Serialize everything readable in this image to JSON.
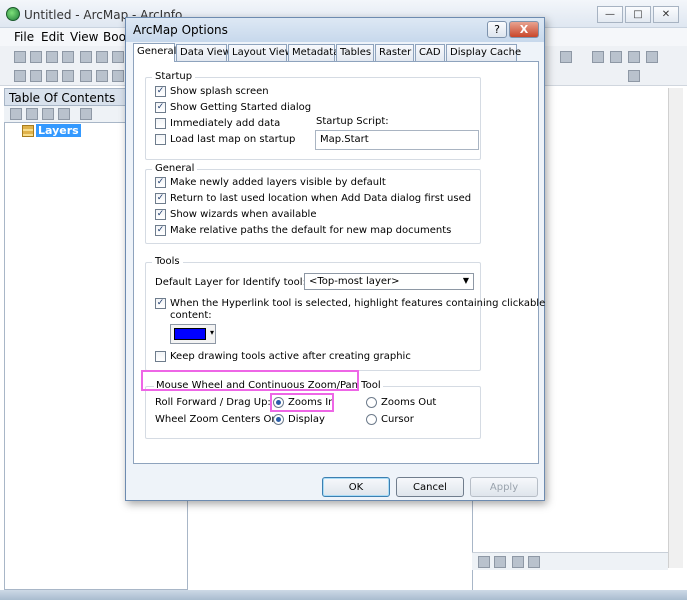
{
  "app": {
    "title": "Untitled - ArcMap - ArcInfo",
    "menu": [
      "File",
      "Edit",
      "View",
      "Book"
    ],
    "toc_title": "Table Of Contents",
    "layers_label": "Layers"
  },
  "dialog": {
    "title": "ArcMap Options",
    "help_label": "?",
    "close_label": "X",
    "tabs": [
      "General",
      "Data View",
      "Layout View",
      "Metadata",
      "Tables",
      "Raster",
      "CAD",
      "Display Cache"
    ],
    "active_tab": "General",
    "startup": {
      "label": "Startup",
      "options": [
        {
          "label": "Show splash screen",
          "checked": true
        },
        {
          "label": "Show Getting Started dialog",
          "checked": true
        },
        {
          "label": "Immediately add data",
          "checked": false
        },
        {
          "label": "Load last map on startup",
          "checked": false
        }
      ],
      "script_label": "Startup Script:",
      "script_value": "Map.Start"
    },
    "general": {
      "label": "General",
      "options": [
        {
          "label": "Make newly added layers visible by default",
          "checked": true
        },
        {
          "label": "Return to last used location when Add Data dialog first used",
          "checked": true
        },
        {
          "label": "Show wizards when available",
          "checked": true
        },
        {
          "label": "Make relative paths the default for new map documents",
          "checked": true
        }
      ]
    },
    "tools": {
      "label": "Tools",
      "default_layer_label": "Default Layer for Identify tool:",
      "default_layer_value": "<Top-most layer>",
      "hyperlink_label_1": "When the Hyperlink tool is selected, highlight features containing clickable",
      "hyperlink_label_2": "content:",
      "hyperlink_checked": true,
      "highlight_color": "#0000ff",
      "keep_drawing_label": "Keep drawing tools active after creating graphic",
      "keep_drawing_checked": false
    },
    "mouse_wheel": {
      "label": "Mouse Wheel and Continuous Zoom/Pan Tool",
      "roll_forward_label": "Roll Forward / Drag Up:",
      "zooms_in": "Zooms In",
      "zooms_out": "Zooms Out",
      "roll_selected": "Zooms In",
      "centers_label": "Wheel Zoom Centers On:",
      "display": "Display",
      "cursor": "Cursor",
      "centers_selected": "Display"
    },
    "buttons": {
      "ok": "OK",
      "cancel": "Cancel",
      "apply": "Apply"
    }
  },
  "annotation_color": "#ee66e6"
}
